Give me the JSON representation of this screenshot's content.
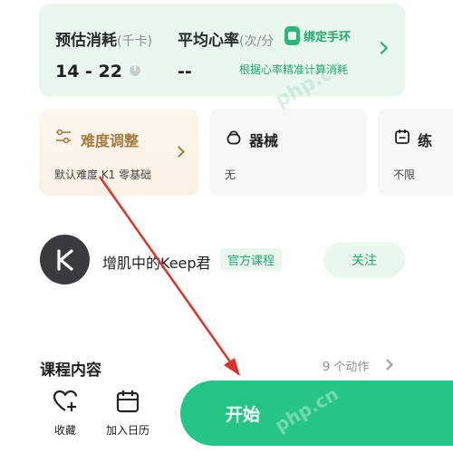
{
  "stats": {
    "calories_label": "预估消耗",
    "calories_unit": "(千卡)",
    "calories_value": "14 - 22",
    "heart_rate_label": "平均心率",
    "heart_rate_unit": "(次/分",
    "heart_rate_value": "--",
    "bind_band_label": "绑定手环",
    "calc_hint": "根据心率精准计算消耗"
  },
  "options": {
    "difficulty_title": "难度调整",
    "difficulty_sub": "默认难度 K1 零基础",
    "equipment_title": "器械",
    "equipment_sub": "无",
    "third_title": "练",
    "third_sub": "不限"
  },
  "author": {
    "name": "增肌中的Keep君",
    "badge": "官方课程",
    "follow_label": "关注"
  },
  "course": {
    "title": "课程内容",
    "action_count": "9 个动作"
  },
  "bottom": {
    "favorite_label": "收藏",
    "calendar_label": "加入日历",
    "start_label": "开始"
  },
  "watermark": {
    "text": "php.cn"
  },
  "colors": {
    "accent_green": "#24c586",
    "card_green": "#e9f7ee",
    "annotation_red": "#d9342b",
    "difficulty_gold": "#a77a3e"
  }
}
